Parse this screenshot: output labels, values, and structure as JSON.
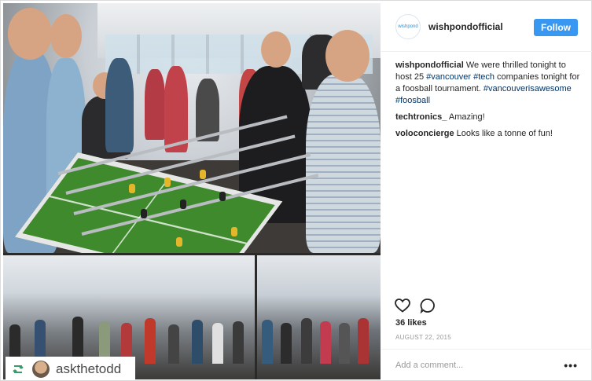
{
  "post": {
    "username": "wishpondofficial",
    "logo_text": "wishpond",
    "follow_label": "Follow",
    "caption": {
      "user": "wishpondofficial",
      "text_1": " We were thrilled tonight to host 25 ",
      "tag_1": "#vancouver",
      "tag_2": "#tech",
      "text_2": " companies tonight for a foosball tournament. ",
      "tag_3": "#vancouverisawesome",
      "tag_4": "#foosball"
    },
    "comments": [
      {
        "user": "techtronics_",
        "text": " Amazing!"
      },
      {
        "user": "voloconcierge",
        "text": " Looks like a tonne of fun!"
      }
    ],
    "likes": "36 likes",
    "date": "AUGUST 22, 2015",
    "comment_placeholder": "Add a comment...",
    "more_label": "•••"
  },
  "repost": {
    "icon": "repost-icon",
    "name": "askthetodd"
  },
  "icons": {
    "like": "heart-icon",
    "comment": "comment-bubble-icon"
  },
  "colors": {
    "follow_bg": "#3897f0",
    "hashtag": "#003569",
    "repost_green": "#3c9a6a"
  }
}
